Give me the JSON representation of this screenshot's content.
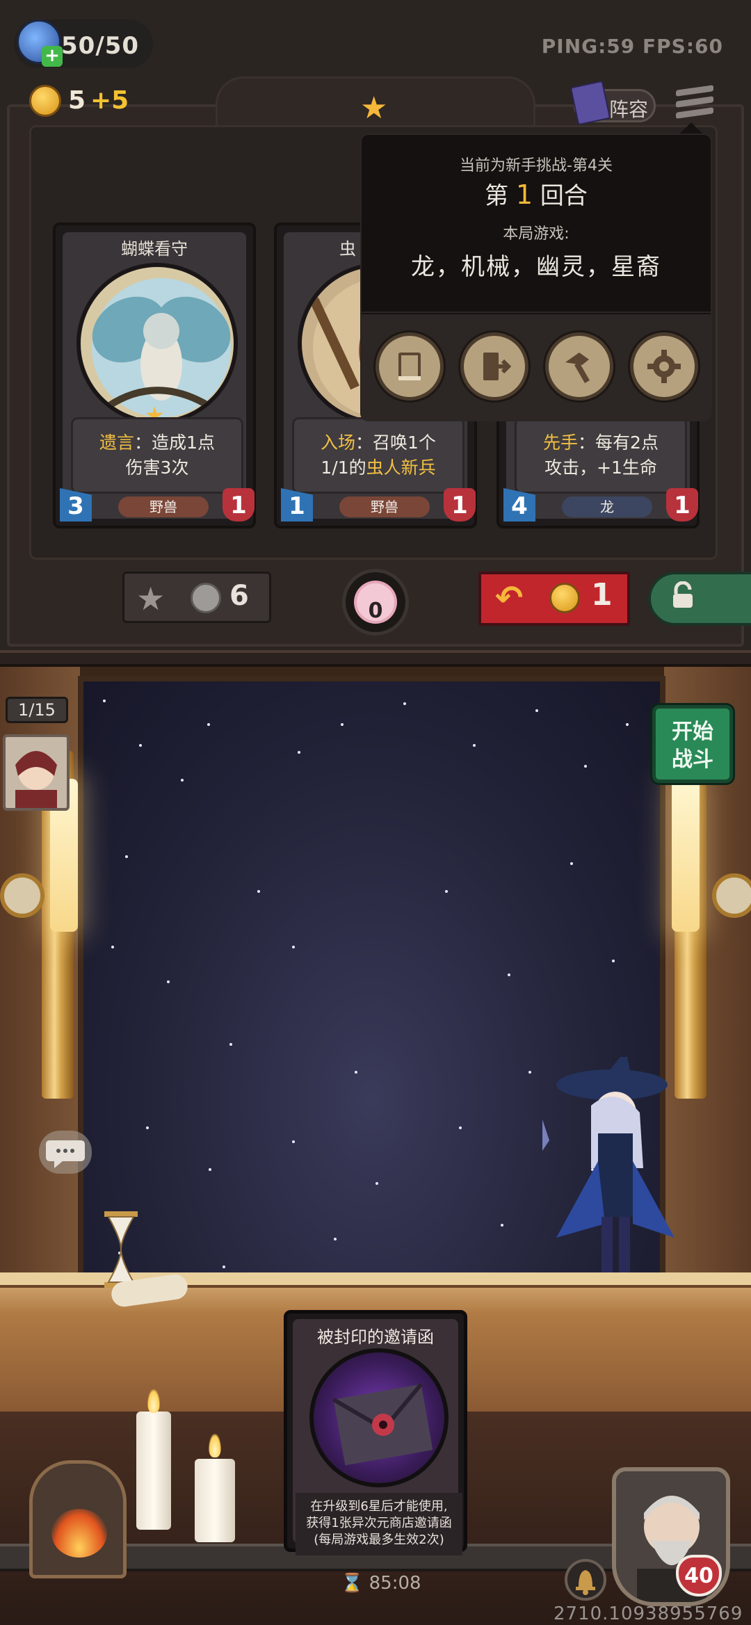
{
  "hud": {
    "hp": "50/50",
    "network": "PING:59   FPS:60",
    "gold": "5",
    "gold_income": "+5",
    "lineup_label": "阵容"
  },
  "popup": {
    "challenge": "当前为新手挑战-第4关",
    "round_prefix": "第",
    "round_number": "1",
    "round_suffix": "回合",
    "tribes_label": "本局游戏:",
    "tribes": "龙，机械，幽灵，星裔",
    "buttons": [
      "book-icon",
      "exit-icon",
      "hammer-icon",
      "gear-icon"
    ]
  },
  "cards": [
    {
      "name": "蝴蝶看守",
      "desc_keyword": "遗言",
      "desc_line1_rest": "：造成1点",
      "desc_line2": "伤害3次",
      "attack": "3",
      "health": "1",
      "tribe": "野兽",
      "tribe_color": "#7a4638"
    },
    {
      "name": "虫",
      "desc_keyword": "入场",
      "desc_line1_rest": "：召唤1个",
      "desc_line2_pre": "1/1的",
      "desc_line2_kw": "虫人新兵",
      "attack": "1",
      "health": "1",
      "tribe": "野兽",
      "tribe_color": "#7a4638"
    },
    {
      "desc_keyword": "先手",
      "desc_line1_rest": "：每有2点",
      "desc_line2": "攻击，+1生命",
      "attack": "4",
      "health": "1",
      "tribe": "龙",
      "tribe_color": "#3c4660"
    }
  ],
  "shop_controls": {
    "upgrade_cost": "6",
    "flower_count": "0",
    "refresh_cost": "1"
  },
  "battle": {
    "opponent_counter": "1/15",
    "start_button": "开始\n战斗",
    "start_line1": "开始",
    "start_line2": "战斗",
    "timer": "85:08",
    "coords": "2710.10938955769",
    "hero_hp": "40"
  },
  "sealed_card": {
    "title": "被封印的邀请函",
    "desc_line1": "在升级到6星后才能使用,",
    "desc_line2": "获得1张异次元商店邀请函",
    "desc_line3": "(每局游戏最多生效2次)"
  },
  "colors": {
    "gold": "#f5b83a",
    "refresh_red": "#c2262d",
    "start_green": "#2a8a57",
    "lock_green": "#326d4e"
  }
}
